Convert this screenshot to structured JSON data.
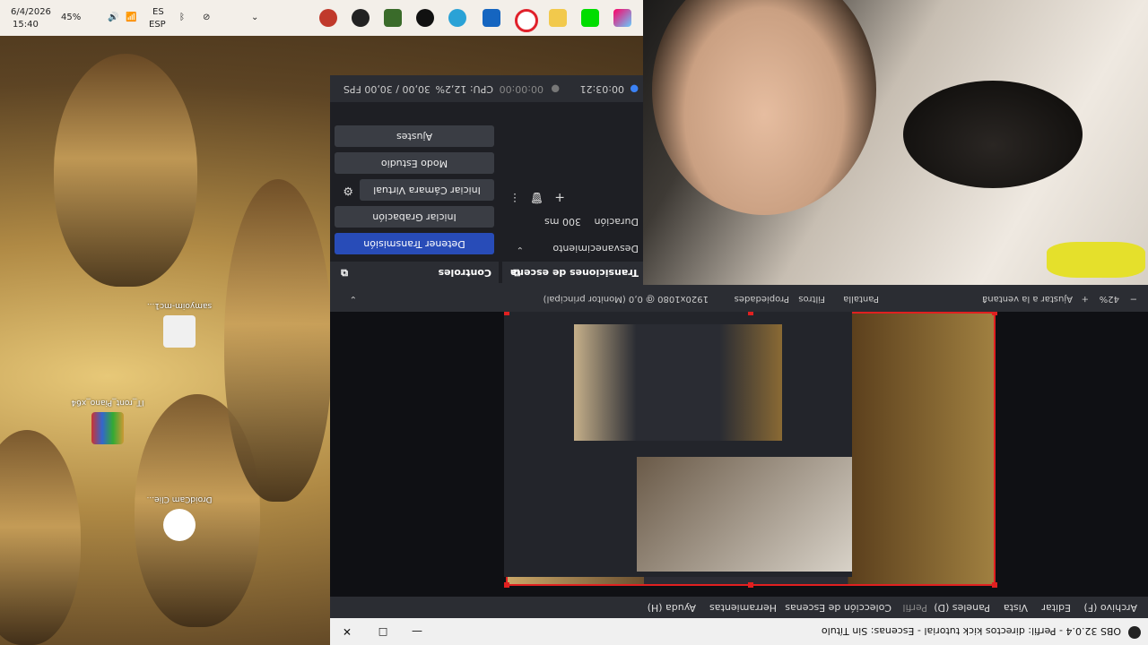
{
  "taskbar": {
    "time": "15:40",
    "date": "6/4/2026",
    "battery": "45%",
    "lang_top": "ES",
    "lang_bottom": "ESP"
  },
  "desktop_icons": [
    {
      "label": "samyoim-mc1..."
    },
    {
      "label": "IT_ront_Piano_x64"
    },
    {
      "label": "DroidCam Clie..."
    }
  ],
  "obs": {
    "title": "OBS 32.0.4 - Perfil: directos kick tutorial - Escenas: Sin Título",
    "menu": [
      "Archivo (F)",
      "Editar",
      "Vista",
      "Paneles (D)",
      "Perfil",
      "Colección de Escenas",
      "Herramientas",
      "Ayuda (H)"
    ],
    "toolbar": {
      "zoom": "42%",
      "fit": "Ajustar a la ventana",
      "source": "Pantalla",
      "filters": "Filtros",
      "properties": "Propiedades",
      "display": "1920x1080 @ 0,0 (Monitor principal)"
    },
    "transitions": {
      "header": "Transiciones de escena",
      "type": "Desvanecimiento",
      "duration_label": "Duración",
      "duration": "300 ms"
    },
    "controls": {
      "header": "Controles",
      "buttons": [
        "Detener Transmisión",
        "Iniciar Grabación",
        "Iniciar Cámara Virtual",
        "Modo Estudio",
        "Ajustes"
      ]
    },
    "status": {
      "live_time": "00:03:21",
      "rec_time": "00:00:00",
      "cpu": "CPU: 12,2%",
      "fps": "30,00 / 30,00 FPS"
    }
  },
  "colors": {
    "accent": "#284cb8",
    "selection": "#e02020"
  }
}
